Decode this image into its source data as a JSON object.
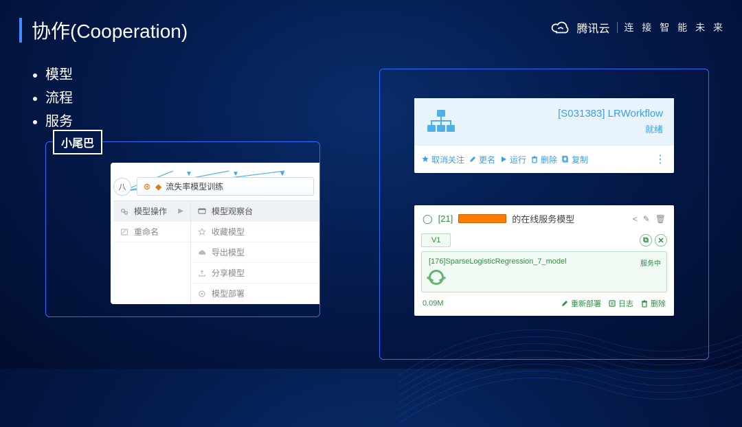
{
  "brand": {
    "name": "腾讯云",
    "tagline": "连 接 智 能 未 来"
  },
  "title": "协作(Cooperation)",
  "bullets": [
    "模型",
    "流程",
    "服务"
  ],
  "left": {
    "tag": "小尾巴",
    "node_badge": "八",
    "node_label": "流失率模型训练",
    "menu_left": [
      {
        "icon": "gears",
        "label": "模型操作",
        "active": true,
        "chevron": true
      },
      {
        "icon": "rename",
        "label": "重命名"
      }
    ],
    "menu_right": [
      {
        "icon": "console",
        "label": "模型观察台",
        "active": true
      },
      {
        "icon": "star",
        "label": "收藏模型"
      },
      {
        "icon": "cloud",
        "label": "导出模型"
      },
      {
        "icon": "share",
        "label": "分享模型"
      },
      {
        "icon": "deploy",
        "label": "模型部署"
      }
    ]
  },
  "workflow": {
    "title": "[S031383] LRWorkflow",
    "status": "就绪",
    "actions": [
      {
        "icon": "star",
        "label": "取消关注"
      },
      {
        "icon": "pencil",
        "label": "更名"
      },
      {
        "icon": "play",
        "label": "运行"
      },
      {
        "icon": "trash",
        "label": "删除"
      },
      {
        "icon": "copy",
        "label": "复制"
      }
    ]
  },
  "service": {
    "id_prefix": "[21]",
    "title_suffix": "的在线服务模型",
    "version_chip": "V1",
    "model_name": "[176]SparseLogisticRegression_7_model",
    "state": "服务中",
    "size": "0.09M",
    "foot_actions": [
      {
        "icon": "pencil",
        "label": "重新部署"
      },
      {
        "icon": "log",
        "label": "日志"
      },
      {
        "icon": "trash",
        "label": "删除"
      }
    ]
  }
}
